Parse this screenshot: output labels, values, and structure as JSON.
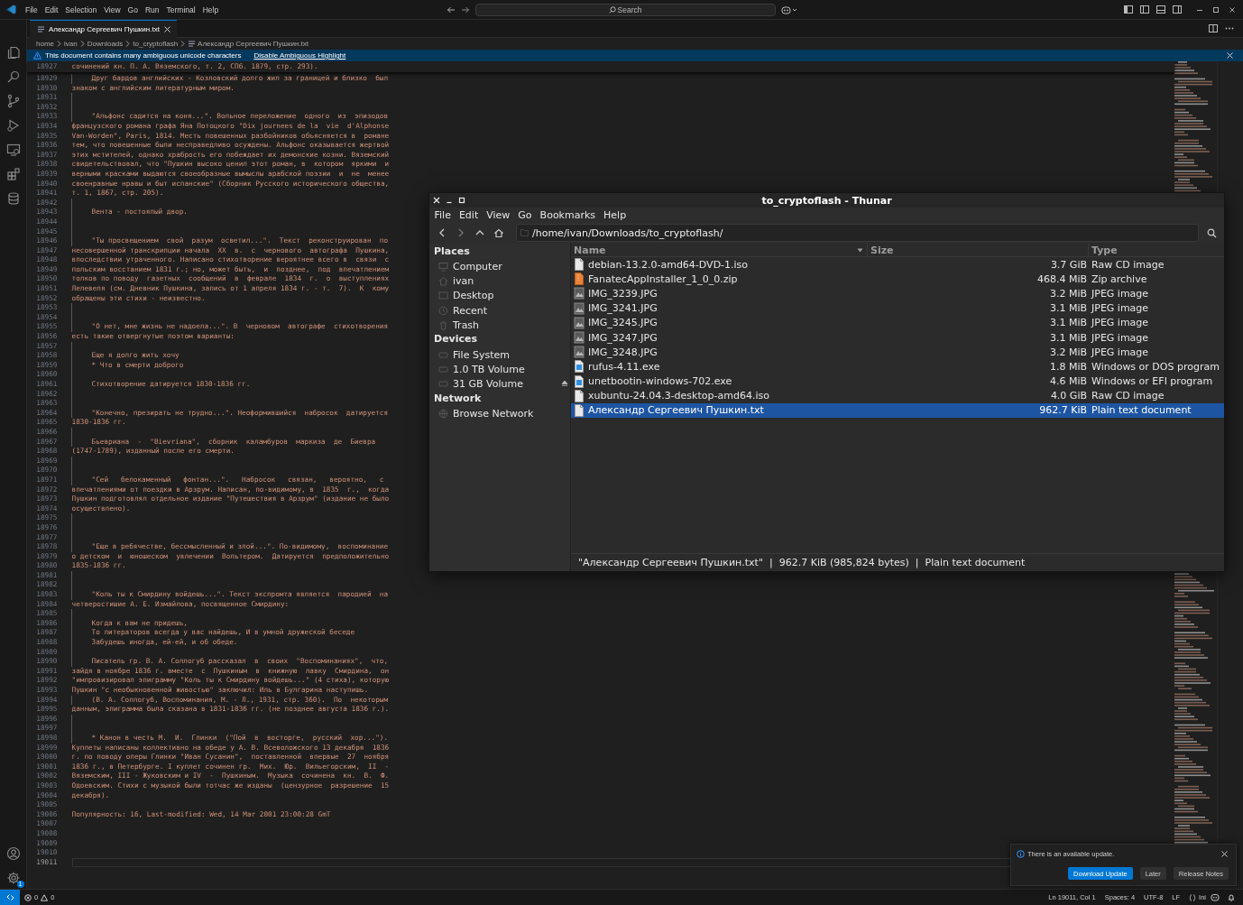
{
  "menu": [
    "File",
    "Edit",
    "Selection",
    "View",
    "Go",
    "Run",
    "Terminal",
    "Help"
  ],
  "command_center": {
    "placeholder": "Search"
  },
  "activity_bar": {
    "manage_badge": "1"
  },
  "tabs": [
    {
      "label": "Александр Сергеевич Пушкин.txt",
      "selected": true
    }
  ],
  "breadcrumb": [
    "home",
    "ivan",
    "Downloads",
    "to_cryptoflash",
    "Александр Сергеевич Пушкин.txt"
  ],
  "banner": {
    "message": "This document contains many ambiguous unicode characters",
    "action": "Disable Ambiguous Highlight"
  },
  "editor": {
    "sticky_line": {
      "number": "18927",
      "text": "сочинений кн. П. А. Вяземского, т. 2, СПб. 1879, стр. 293)."
    },
    "lines": [
      {
        "number": "18929",
        "text": "Друг бардов английских - Козловский долго жил за границей и близко  был",
        "indented": true,
        "current": false
      },
      {
        "number": "18930",
        "text": "знаком с английским литературным миром.",
        "indented": false,
        "current": false
      },
      {
        "number": "18931",
        "indented": true,
        "current": false
      },
      {
        "number": "18932",
        "indented": true,
        "current": false
      },
      {
        "number": "18933",
        "text": "\"Альфонс садится на коня...\". Вольное переложение  одного  из  эпизодов",
        "indented": true,
        "current": false
      },
      {
        "number": "18934",
        "text": "французского романа графа Яна Потоцкого \"Dix journees de la  vie  d'Alphonse",
        "indented": false,
        "current": false
      },
      {
        "number": "18935",
        "text": "Van-Worden\", Paris, 1814. Месть повешенных разбойников объясняется в  романе",
        "indented": false,
        "current": false
      },
      {
        "number": "18936",
        "text": "тем, что повешенные были несправедливо осуждены. Альфонс оказывается жертвой",
        "indented": false,
        "current": false
      },
      {
        "number": "18937",
        "text": "этих мстителей, однако храбрость его побеждает их демонские козни. Вяземский",
        "indented": false,
        "current": false
      },
      {
        "number": "18938",
        "text": "свидетельствовал, что \"Пушкин высоко ценил этот роман, в  котором  яркими  и",
        "indented": false,
        "current": false
      },
      {
        "number": "18939",
        "text": "верными красками выдаются своеобразные вымыслы арабской поэзии  и  не  менее",
        "indented": false,
        "current": false
      },
      {
        "number": "18940",
        "text": "своенравные нравы и быт испанские\" (Сборник Русского исторического общества,",
        "indented": false,
        "current": false
      },
      {
        "number": "18941",
        "text": "т. 1, 1867, стр. 205).",
        "indented": false,
        "current": false
      },
      {
        "number": "18942",
        "indented": true,
        "current": false
      },
      {
        "number": "18943",
        "text": "Вента - постоялый двор.",
        "indented": true,
        "current": false
      },
      {
        "number": "18944",
        "indented": true,
        "current": false
      },
      {
        "number": "18945",
        "indented": true,
        "current": false
      },
      {
        "number": "18946",
        "text": "\"Ты просвещением  свой  разум  осветил...\".  Текст  реконструирован  по",
        "indented": true,
        "current": false
      },
      {
        "number": "18947",
        "text": "несовершенной транскрипции начала  XX  в.  с  чернового  автографа  Пушкина,",
        "indented": false,
        "current": false
      },
      {
        "number": "18948",
        "text": "впоследствии утраченного. Написано стихотворение вероятнее всего в  связи  с",
        "indented": false,
        "current": false
      },
      {
        "number": "18949",
        "text": "польским восстанием 1831 г.; но, может быть,  и  позднее,  под  впечатлением",
        "indented": false,
        "current": false
      },
      {
        "number": "18950",
        "text": "толков по поводу  газетных  сообщений  в  феврале  1834  г.  о  выступлениях",
        "indented": false,
        "current": false
      },
      {
        "number": "18951",
        "text": "Лелевеля (см. Дневник Пушкина, запись от 1 апреля 1834 г. - т.  7).  К  кому",
        "indented": false,
        "current": false
      },
      {
        "number": "18952",
        "text": "обращены эти стихи - неизвестно.",
        "indented": false,
        "current": false
      },
      {
        "number": "18953",
        "indented": true,
        "current": false
      },
      {
        "number": "18954",
        "indented": true,
        "current": false
      },
      {
        "number": "18955",
        "text": "\"О нет, мне жизнь не надоела...\". В  черновом  автографе  стихотворения",
        "indented": true,
        "current": false
      },
      {
        "number": "18956",
        "text": "есть такие отвергнутые поэтом варианты:",
        "indented": false,
        "current": false
      },
      {
        "number": "18957",
        "indented": true,
        "current": false
      },
      {
        "number": "18958",
        "text": "Еще я долго жить хочу",
        "indented": true,
        "current": false
      },
      {
        "number": "18959",
        "text": "* Что в смерти доброго",
        "indented": true,
        "current": false
      },
      {
        "number": "18960",
        "indented": true,
        "current": false
      },
      {
        "number": "18961",
        "text": "Стихотворение датируется 1830-1836 гг.",
        "indented": true,
        "current": false
      },
      {
        "number": "18962",
        "indented": true,
        "current": false
      },
      {
        "number": "18963",
        "indented": true,
        "current": false
      },
      {
        "number": "18964",
        "text": "\"Конечно, презирать не трудно...\". Неоформившийся  набросок  датируется",
        "indented": true,
        "current": false
      },
      {
        "number": "18965",
        "text": "1830-1836 гг.",
        "indented": false,
        "current": false
      },
      {
        "number": "18966",
        "indented": true,
        "current": false
      },
      {
        "number": "18967",
        "text": "Бьевриана  -  \"Bievriana\",  сборник  каламбуров  маркиза  де  Биевра",
        "indented": true,
        "current": false
      },
      {
        "number": "18968",
        "text": "(1747-1789), изданный после его смерти.",
        "indented": false,
        "current": false
      },
      {
        "number": "18969",
        "indented": true,
        "current": false
      },
      {
        "number": "18970",
        "indented": true,
        "current": false
      },
      {
        "number": "18971",
        "text": "\"Сей   белокаменный   фонтан...\".   Набросок   связан,   вероятно,   с",
        "indented": true,
        "current": false
      },
      {
        "number": "18972",
        "text": "впечатлениями от поездки в Арзрум. Написан, по-видимому, в  1835  г.,  когда",
        "indented": false,
        "current": false
      },
      {
        "number": "18973",
        "text": "Пушкин подготовлял отдельное издание \"Путешествия в Арзрум\" (издание не было",
        "indented": false,
        "current": false
      },
      {
        "number": "18974",
        "text": "осуществлено).",
        "indented": false,
        "current": false
      },
      {
        "number": "18975",
        "indented": true,
        "current": false
      },
      {
        "number": "18976",
        "indented": true,
        "current": false
      },
      {
        "number": "18977",
        "indented": true,
        "current": false
      },
      {
        "number": "18978",
        "text": "\"Еще в ребячестве, бессмысленный и злой...\". По-видимому,  воспоминание",
        "indented": true,
        "current": false
      },
      {
        "number": "18979",
        "text": "о детском  и  юношеском  увлечении  Вольтером.  Датируется  предположительно",
        "indented": false,
        "current": false
      },
      {
        "number": "18980",
        "text": "1835-1836 гг.",
        "indented": false,
        "current": false
      },
      {
        "number": "18981",
        "indented": true,
        "current": false
      },
      {
        "number": "18982",
        "indented": true,
        "current": false
      },
      {
        "number": "18983",
        "text": "\"Коль ты к Смирдину войдешь...\". Текст экспромта является  пародией  на",
        "indented": true,
        "current": false
      },
      {
        "number": "18984",
        "text": "четверостишие А. Е. Измайлова, посвященное Смирдину:",
        "indented": false,
        "current": false
      },
      {
        "number": "18985",
        "indented": true,
        "current": false
      },
      {
        "number": "18986",
        "text": "Когда к вам не придешь,",
        "indented": true,
        "current": false
      },
      {
        "number": "18987",
        "text": "То литераторов всегда у вас найдешь, И в умной дружеской беседе",
        "indented": true,
        "current": false
      },
      {
        "number": "18988",
        "text": "Забудешь иногда, ей-ей, и об обеде.",
        "indented": true,
        "current": false
      },
      {
        "number": "18989",
        "indented": true,
        "current": false
      },
      {
        "number": "18990",
        "text": "Писатель гр. В. А. Соллогуб рассказал  в  своих  \"Воспоминаниях\",  что,",
        "indented": true,
        "current": false
      },
      {
        "number": "18991",
        "text": "зайдя в ноябре 1836 г. вместе  с  Пушкиным  в  книжную  лавку  Смирдина,  он",
        "indented": false,
        "current": false
      },
      {
        "number": "18992",
        "text": "\"импровизировал эпиграмму \"Коль ты к Смирдину войдешь...\" (4 стиха), которую",
        "indented": false,
        "current": false
      },
      {
        "number": "18993",
        "text": "Пушкин \"с необыкновенной живостью\" заключил: Иль в Булгарина наступишь.",
        "indented": false,
        "current": false
      },
      {
        "number": "18994",
        "text": "(В. А. Соллогуб, Воспоминания, М. - Л., 1931, стр. 360).  По  некоторым",
        "indented": true,
        "current": false
      },
      {
        "number": "18995",
        "text": "данным, эпиграмма была сказана в 1831-1836 гг. (не позднее августа 1836 г.).",
        "indented": false,
        "current": false
      },
      {
        "number": "18996",
        "indented": true,
        "current": false
      },
      {
        "number": "18997",
        "indented": true,
        "current": false
      },
      {
        "number": "18998",
        "text": "* Канон в честь М.  И.  Глинки  (\"Пой  в  восторге,  русский  хор...\").",
        "indented": true,
        "current": false
      },
      {
        "number": "18999",
        "text": "Куплеты написаны коллективно на обеде у А. В. Всеволожского 13 декабря  1836",
        "indented": false,
        "current": false
      },
      {
        "number": "19000",
        "text": "г. по поводу оперы Глинки \"Иван Сусанин\",  поставленной  впервые  27  ноября",
        "indented": false,
        "current": false
      },
      {
        "number": "19001",
        "text": "1836 г., в Петербурге. I куплет сочинен гр.  Мих.  Юр.  Вильегорским,  II  -",
        "indented": false,
        "current": false
      },
      {
        "number": "19002",
        "text": "Вяземским, III - Жуковским и IV  -  Пушкиным.  Музыка  сочинена  кн.  В.  Ф.",
        "indented": false,
        "current": false
      },
      {
        "number": "19003",
        "text": "Одоевским. Стихи с музыкой были тотчас же изданы  (цензурное  разрешение  15",
        "indented": false,
        "current": false
      },
      {
        "number": "19004",
        "text": "декабря).",
        "indented": false,
        "current": false
      },
      {
        "number": "19005",
        "indented": false,
        "current": false
      },
      {
        "number": "19006",
        "text": "Популярность: 16, Last-modified: Wed, 14 Mar 2001 23:00:28 GmT",
        "indented": false,
        "current": false
      },
      {
        "number": "19007",
        "indented": false,
        "current": false
      },
      {
        "number": "19008",
        "indented": false,
        "current": false
      },
      {
        "number": "19009",
        "indented": false,
        "current": false
      },
      {
        "number": "19010",
        "indented": false,
        "current": false
      },
      {
        "number": "19011",
        "indented": false,
        "current": true
      }
    ]
  },
  "file_manager": {
    "title": "to_cryptoflash - Thunar",
    "menu": [
      "File",
      "Edit",
      "View",
      "Go",
      "Bookmarks",
      "Help"
    ],
    "path": "/home/ivan/Downloads/to_cryptoflash/",
    "sidebar": [
      {
        "heading": "Places",
        "items": [
          {
            "label": "Computer",
            "kind": "computer",
            "eject": false
          },
          {
            "label": "ivan",
            "kind": "home",
            "eject": false
          },
          {
            "label": "Desktop",
            "kind": "desktop",
            "eject": false
          },
          {
            "label": "Recent",
            "kind": "clock",
            "eject": false
          },
          {
            "label": "Trash",
            "kind": "trash",
            "eject": false
          }
        ]
      },
      {
        "heading": "Devices",
        "items": [
          {
            "label": "File System",
            "kind": "drive",
            "eject": false
          },
          {
            "label": "1.0 TB Volume",
            "kind": "drive",
            "eject": false
          },
          {
            "label": "31 GB Volume",
            "kind": "drive",
            "eject": true
          }
        ]
      },
      {
        "heading": "Network",
        "items": [
          {
            "label": "Browse Network",
            "kind": "network",
            "eject": false
          }
        ]
      }
    ],
    "columns": [
      {
        "label": "Name",
        "sorted": true
      },
      {
        "label": "Size",
        "sorted": false
      },
      {
        "label": "Type",
        "sorted": false
      }
    ],
    "files": [
      {
        "name": "debian-13.2.0-amd64-DVD-1.iso",
        "size": "3.7 GiB",
        "type": "Raw CD image",
        "kind": "document",
        "selected": false
      },
      {
        "name": "FanatecAppInstaller_1_0_0.zip",
        "size": "468.4 MiB",
        "type": "Zip archive",
        "kind": "archive",
        "selected": false
      },
      {
        "name": "IMG_3239.JPG",
        "size": "3.2 MiB",
        "type": "JPEG image",
        "kind": "photo",
        "selected": false
      },
      {
        "name": "IMG_3241.JPG",
        "size": "3.1 MiB",
        "type": "JPEG image",
        "kind": "photo",
        "selected": false
      },
      {
        "name": "IMG_3245.JPG",
        "size": "3.1 MiB",
        "type": "JPEG image",
        "kind": "photo",
        "selected": false
      },
      {
        "name": "IMG_3247.JPG",
        "size": "3.1 MiB",
        "type": "JPEG image",
        "kind": "photo",
        "selected": false
      },
      {
        "name": "IMG_3248.JPG",
        "size": "3.2 MiB",
        "type": "JPEG image",
        "kind": "photo",
        "selected": false
      },
      {
        "name": "rufus-4.11.exe",
        "size": "1.8 MiB",
        "type": "Windows or DOS program",
        "kind": "program",
        "selected": false
      },
      {
        "name": "unetbootin-windows-702.exe",
        "size": "4.6 MiB",
        "type": "Windows or EFI program",
        "kind": "program",
        "selected": false
      },
      {
        "name": "xubuntu-24.04.3-desktop-amd64.iso",
        "size": "4.0 GiB",
        "type": "Raw CD image",
        "kind": "document",
        "selected": false
      },
      {
        "name": "Александр Сергеевич Пушкин.txt",
        "size": "962.7 KiB",
        "type": "Plain text document",
        "kind": "document",
        "selected": true
      }
    ],
    "status": "\"Александр Сергеевич Пушкин.txt\"  |  962.7 KiB (985,824 bytes)  |  Plain text document"
  },
  "notification": {
    "message": "There is an available update.",
    "buttons": [
      {
        "label": "Download Update",
        "primary": true
      },
      {
        "label": "Later",
        "primary": false
      },
      {
        "label": "Release Notes",
        "primary": false
      }
    ]
  },
  "status_bar": {
    "errors": "0",
    "warnings": "0",
    "position": "Ln 19011, Col 1",
    "indentation": "Spaces: 4",
    "encoding": "UTF-8",
    "eol": "LF",
    "language": "Ini"
  }
}
